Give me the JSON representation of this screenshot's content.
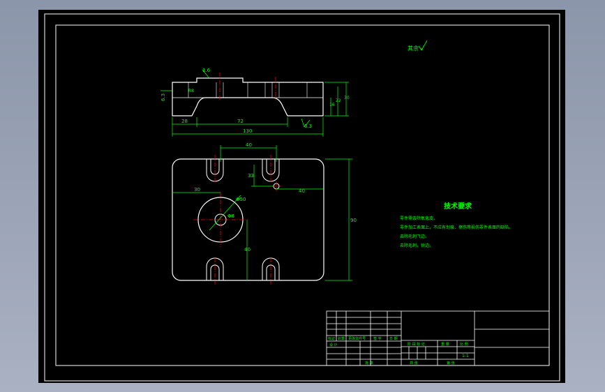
{
  "colors": {
    "background": "#000000",
    "line": "#ffffff",
    "dimension": "#00ff00",
    "centerline": "#ff0000",
    "frame_outer": "#8c96aa"
  },
  "drawing": {
    "roughness_note": "其余 √",
    "side_view": {
      "dim_top_left": "1.6",
      "dim_left": "6.3",
      "dim_bottom_left": "28",
      "dim_bottom_mid": "72",
      "dim_total_width": "130",
      "dim_right_inner": "16",
      "dim_right_mid": "22",
      "dim_right_outer": "30",
      "dim_roughness_right": "6.3",
      "dim_chamfer": "R8"
    },
    "plan_view": {
      "dim_slot_spacing": "40",
      "dim_slot_depth": "33",
      "dim_hole_offset_x": "40",
      "dim_center_x": "30",
      "dim_bore_dia": "Φ50",
      "dim_hole_dia": "Φ8",
      "dim_lower_y": "40",
      "dim_height": "90"
    }
  },
  "tech_req": {
    "title": "技术要求",
    "lines": [
      "零件需去除氧化皮。",
      "零件加工表面上，不应有划痕、擦伤等损伤零件表面的缺陷。",
      "去除毛刺飞边。",
      "去除毛刺，锐边。"
    ]
  },
  "title_block": {
    "labels_row": [
      "标记",
      "处数",
      "更改文件号",
      "签 字",
      "日 期"
    ],
    "design": "设 计",
    "stage_labels": [
      "阶 段 标 记",
      "重 量",
      "比 例"
    ],
    "scale": "1:1",
    "approve": "批 准",
    "sheet_total": "共   张",
    "sheet_no": "第   张"
  }
}
